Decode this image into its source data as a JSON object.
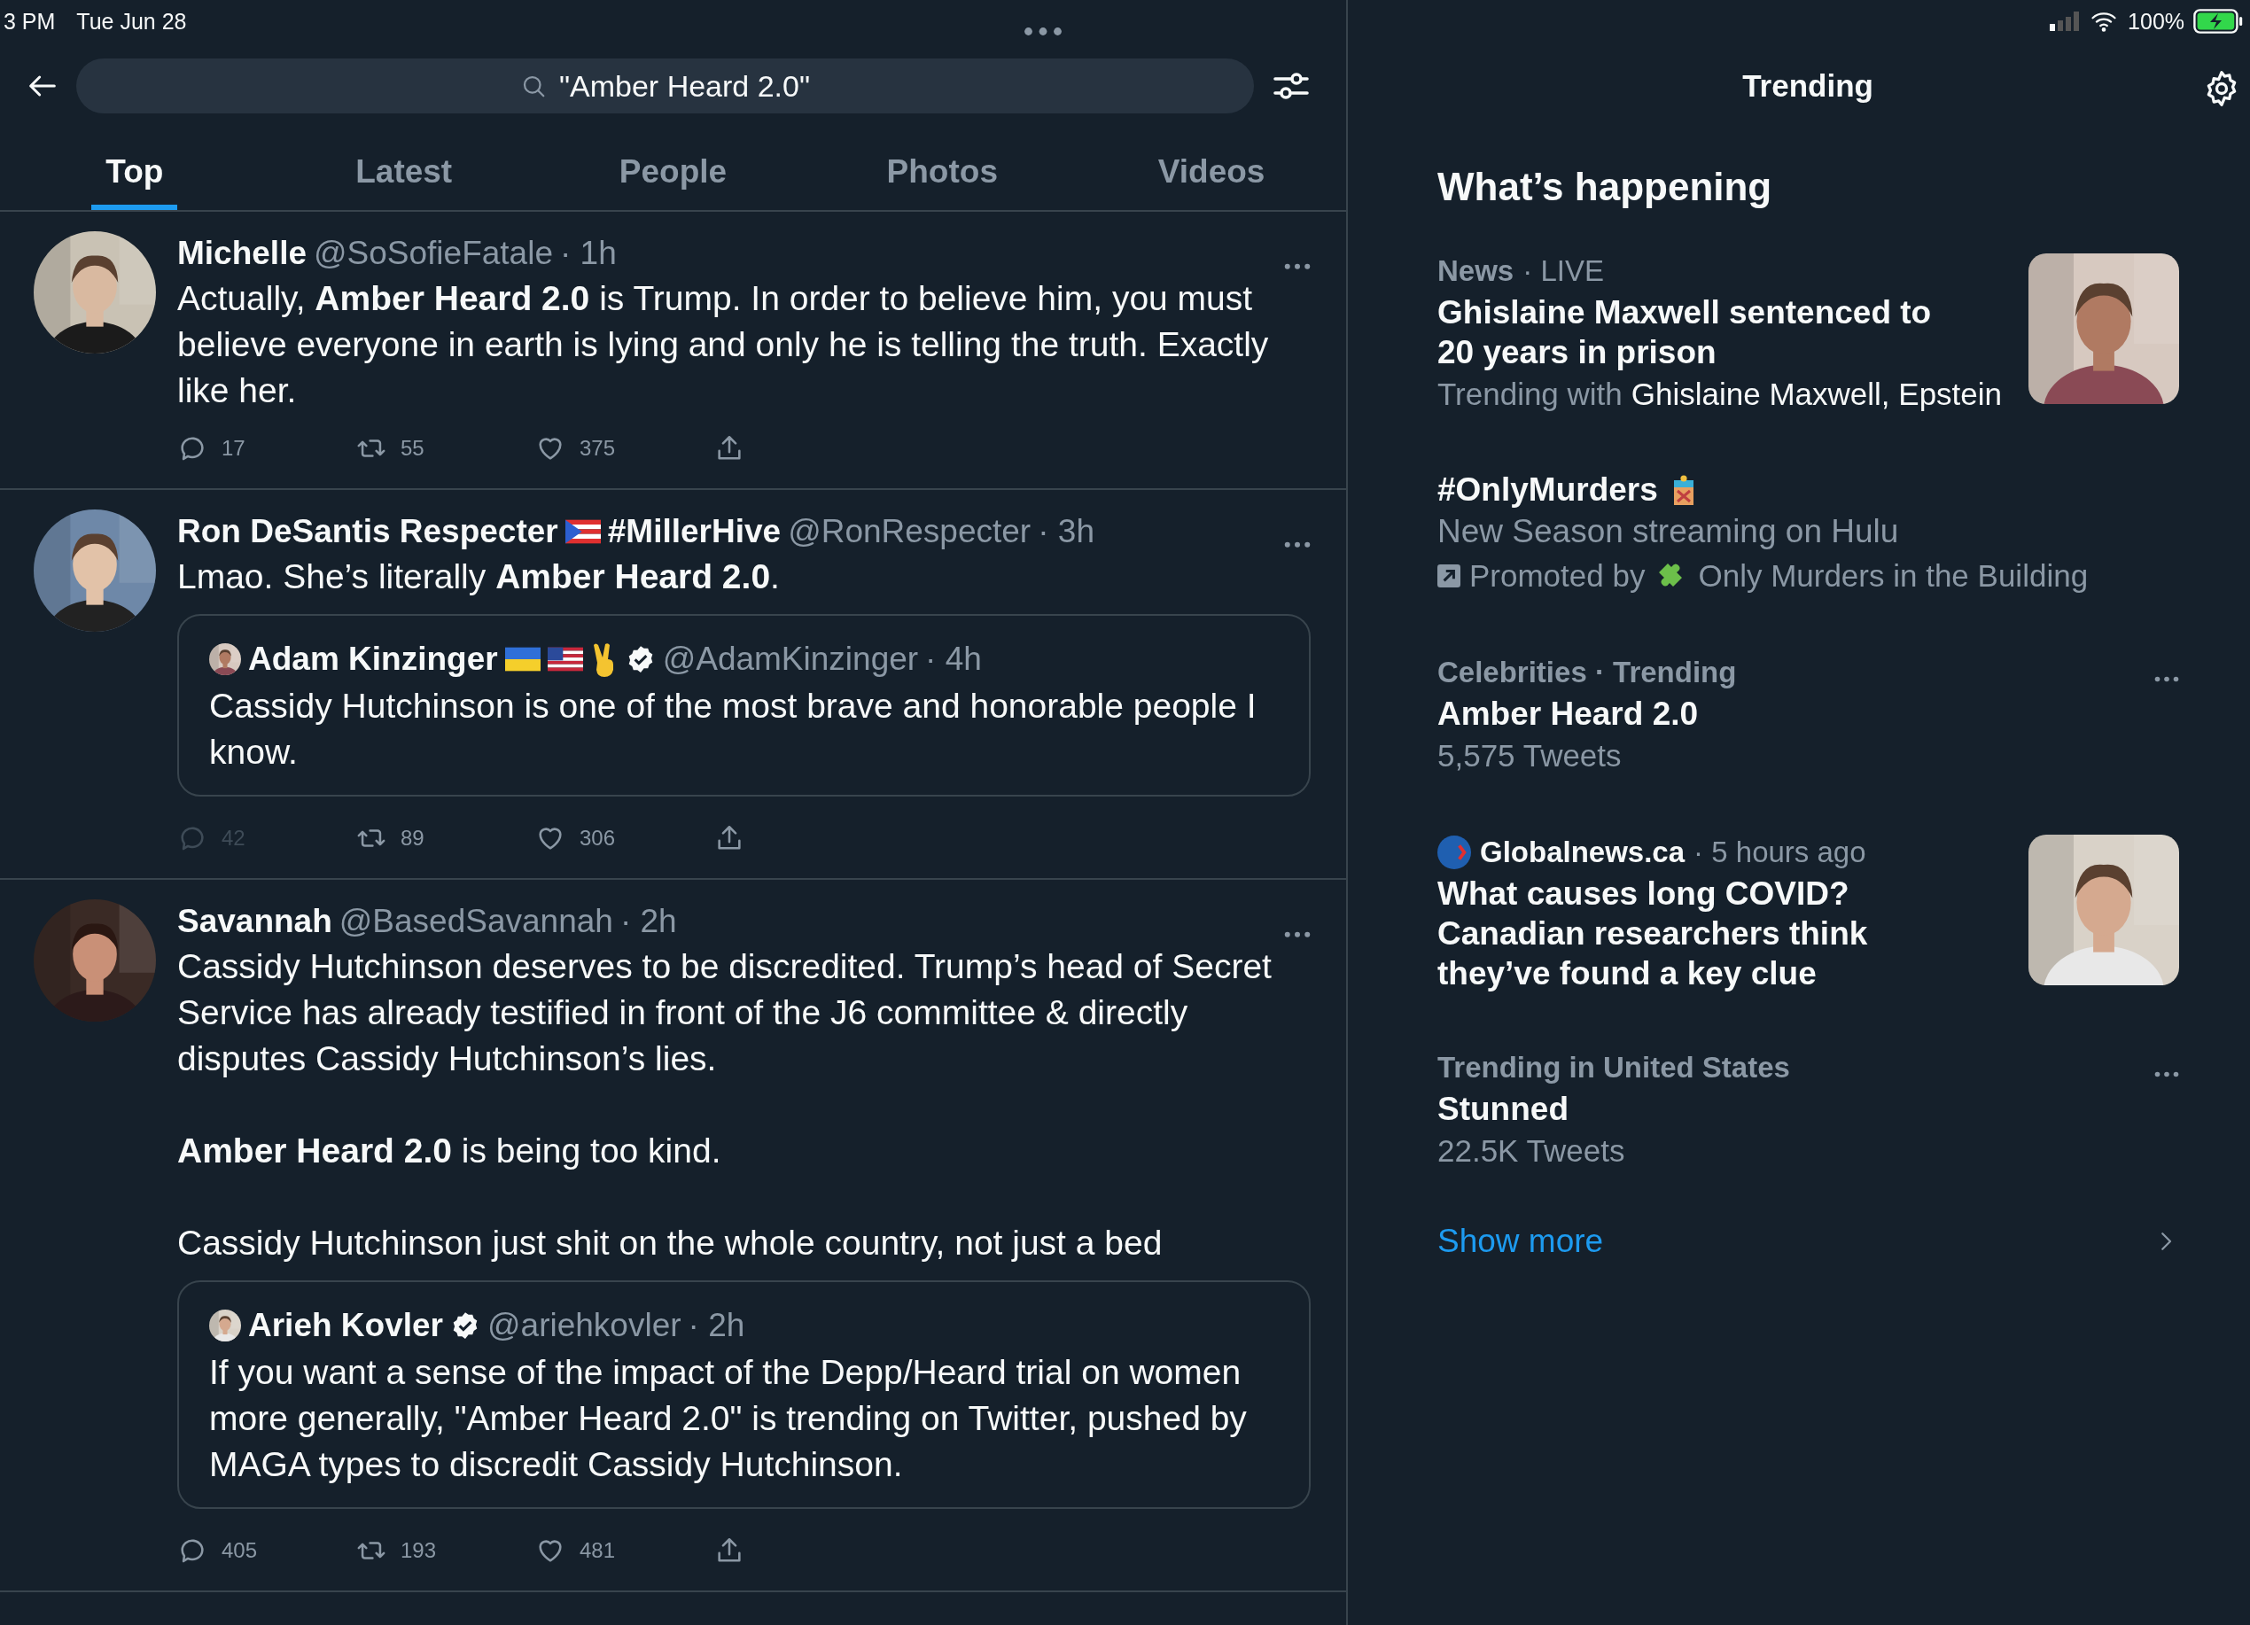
{
  "status_bar": {
    "time": "3 PM",
    "date": "Tue Jun 28",
    "battery": "100%"
  },
  "search": {
    "query": "\"Amber Heard 2.0\""
  },
  "tabs": [
    {
      "label": "Top",
      "selected": true
    },
    {
      "label": "Latest",
      "selected": false
    },
    {
      "label": "People",
      "selected": false
    },
    {
      "label": "Photos",
      "selected": false
    },
    {
      "label": "Videos",
      "selected": false
    }
  ],
  "tweets": [
    {
      "name": "Michelle",
      "handle": "@SoSofieFatale",
      "time": "· 1h",
      "paragraphs": [
        "Actually, **Amber Heard 2.0** is Trump. In order to believe him, you must believe everyone in earth is lying and only he is telling the truth. Exactly like her."
      ],
      "actions": [
        {
          "kind": "reply",
          "count": "17",
          "dimmed": false
        },
        {
          "kind": "retweet",
          "count": "55",
          "dimmed": false
        },
        {
          "kind": "like",
          "count": "375",
          "dimmed": false
        },
        {
          "kind": "share",
          "dimmed": false
        }
      ]
    },
    {
      "name": "Ron DeSantis Respecter",
      "badges": [
        {
          "kind": "flag-pr"
        }
      ],
      "name_extra": "#MillerHive",
      "handle": "@RonRespecter",
      "time": "· 3h",
      "paragraphs": [
        "Lmao. She’s literally **Amber Heard 2.0**."
      ],
      "quote": {
        "name": "Adam Kinzinger",
        "badges": [
          {
            "kind": "flag-ua"
          },
          {
            "kind": "flag-us"
          },
          {
            "kind": "victory"
          }
        ],
        "verified": true,
        "handle": "@AdamKinzinger",
        "time": "· 4h",
        "text": "Cassidy Hutchinson is one of the most brave and honorable people I know."
      },
      "actions": [
        {
          "kind": "reply",
          "count": "42",
          "dimmed": true
        },
        {
          "kind": "retweet",
          "count": "89",
          "dimmed": false
        },
        {
          "kind": "like",
          "count": "306",
          "dimmed": false
        },
        {
          "kind": "share",
          "dimmed": false
        }
      ]
    },
    {
      "name": "Savannah",
      "handle": "@BasedSavannah",
      "time": "· 2h",
      "paragraphs": [
        "Cassidy Hutchinson deserves to be discredited. Trump’s head of Secret Service has already testified in front of the J6 committee & directly disputes Cassidy Hutchinson’s lies.",
        "**Amber Heard 2.0** is being too kind.",
        "Cassidy Hutchinson just shit on the whole country, not just a bed"
      ],
      "quote": {
        "name": "Arieh Kovler",
        "verified": true,
        "handle": "@ariehkovler",
        "time": "· 2h",
        "text": "If you want a sense of the impact of the Depp/Heard trial on women more generally, \"Amber Heard 2.0\" is trending on Twitter, pushed by MAGA types to discredit Cassidy Hutchinson."
      },
      "actions": [
        {
          "kind": "reply",
          "count": "405",
          "dimmed": false
        },
        {
          "kind": "retweet",
          "count": "193",
          "dimmed": false
        },
        {
          "kind": "like",
          "count": "481",
          "dimmed": false
        },
        {
          "kind": "share",
          "dimmed": false
        }
      ]
    }
  ],
  "sidebar": {
    "title": "Trending",
    "heading": "What’s happening",
    "trends": [
      {
        "kind": "news",
        "meta_category": "News",
        "meta_extra": "· LIVE",
        "title": "Ghislaine Maxwell sentenced to 20 years in prison",
        "trending_prefix": "Trending with",
        "trending_names": "Ghislaine Maxwell, Epstein"
      },
      {
        "kind": "promoted",
        "title": "#OnlyMurders",
        "description": "New Season streaming on Hulu",
        "promoted_prefix": "Promoted by",
        "advertiser": "Only Murders in the Building"
      },
      {
        "kind": "trend",
        "meta": "Celebrities · Trending",
        "title": "Amber Heard 2.0",
        "count": "5,575 Tweets"
      },
      {
        "kind": "article",
        "source": "Globalnews.ca",
        "time": "· 5 hours ago",
        "title": "What causes long COVID? Canadian researchers think they’ve found a key clue"
      },
      {
        "kind": "trend",
        "meta": "Trending in United States",
        "title": "Stunned",
        "count": "22.5K Tweets"
      }
    ],
    "show_more": "Show more"
  }
}
